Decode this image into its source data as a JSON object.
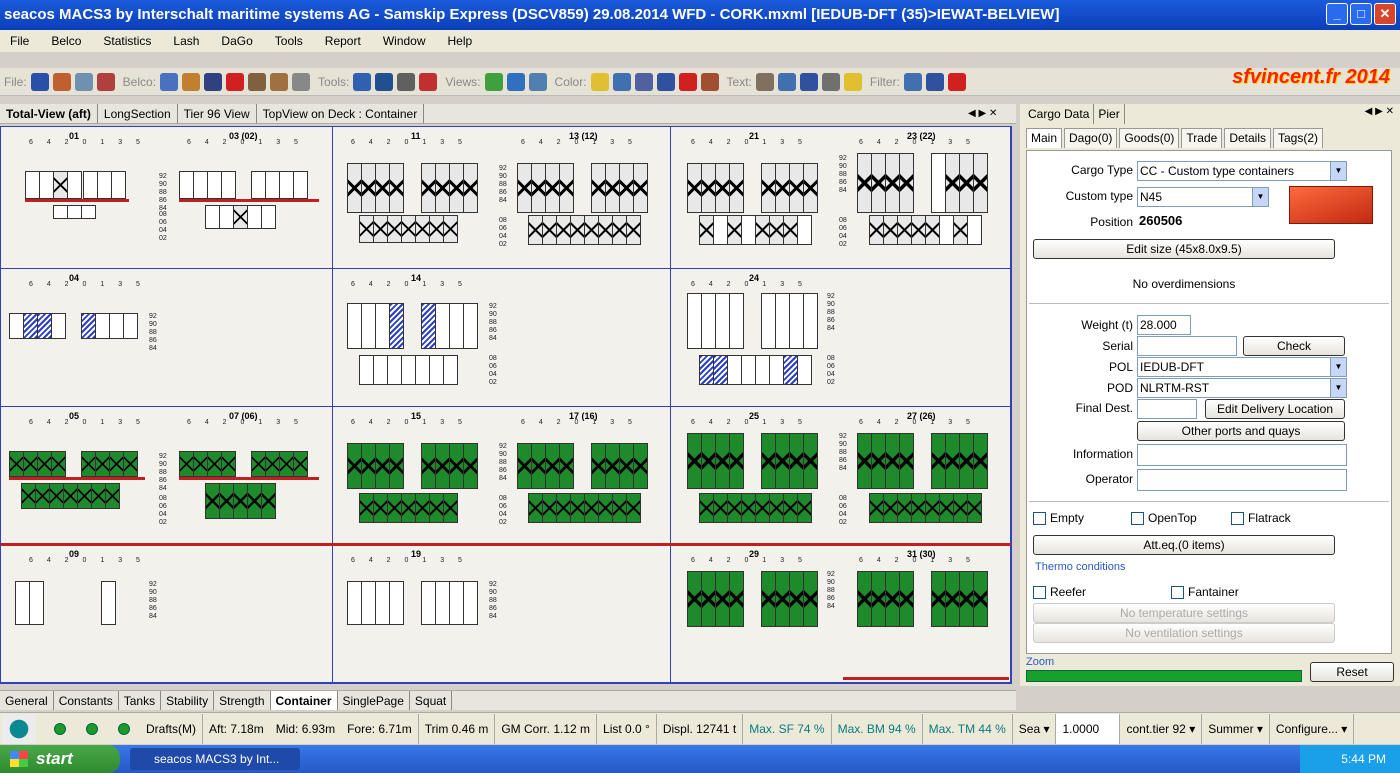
{
  "window": {
    "title": "seacos MACS3 by Interschalt maritime systems AG - Samskip Express (DSCV859)   29.08.2014     WFD - CORK.mxml [IEDUB-DFT (35)>IEWAT-BELVIEW]"
  },
  "menu": [
    "File",
    "Belco",
    "Statistics",
    "Lash",
    "DaGo",
    "Tools",
    "Report",
    "Window",
    "Help"
  ],
  "toolbar": {
    "groups": [
      "File:",
      "Belco:",
      "Tools:",
      "Views:",
      "Color:",
      "Text:",
      "Filter:"
    ]
  },
  "watermark": "sfvincent.fr 2014",
  "view_tabs": [
    {
      "label": "Total-View (aft)",
      "active": true
    },
    {
      "label": "LongSection"
    },
    {
      "label": "Tier 96 View"
    },
    {
      "label": "TopView on Deck : Container"
    }
  ],
  "bays": {
    "b01": "01",
    "b03": "03 (02)",
    "b11": "11",
    "b13": "13 (12)",
    "b21": "21",
    "b23": "23 (22)",
    "b04": "04",
    "b14": "14",
    "b24": "24",
    "b05": "05",
    "b07": "07 (06)",
    "b15": "15",
    "b17": "17 (16)",
    "b25": "25",
    "b27": "27 (26)",
    "b09": "09",
    "b19": "19",
    "b29": "29",
    "b31": "31 (30)"
  },
  "tiers_deck": [
    "92",
    "90",
    "88",
    "86",
    "84"
  ],
  "tiers_hold": [
    "08",
    "06",
    "04",
    "02"
  ],
  "positions": "6 4 2 0 1 3 5",
  "bottom_tabs": [
    {
      "label": "General"
    },
    {
      "label": "Constants"
    },
    {
      "label": "Tanks"
    },
    {
      "label": "Stability"
    },
    {
      "label": "Strength"
    },
    {
      "label": "Container",
      "active": true
    },
    {
      "label": "SinglePage"
    },
    {
      "label": "Squat"
    }
  ],
  "status": {
    "drafts": "Drafts(M)",
    "aft": "Aft: 7.18m",
    "mid": "Mid: 6.93m",
    "fore": "Fore: 6.71m",
    "trim": "Trim 0.46 m",
    "gm": "GM Corr. 1.12 m",
    "list": "List 0.0 °",
    "displ": "Displ. 12741 t",
    "sf": "Max. SF 74 %",
    "bm": "Max. BM 94 %",
    "tm": "Max. TM 44 %",
    "sea": "Sea",
    "factor": "1.0000",
    "tier": "cont.tier 92",
    "season": "Summer",
    "configure": "Configure..."
  },
  "taskbar": {
    "start": "start",
    "task": "seacos MACS3 by Int...",
    "clock": "5:44 PM"
  },
  "panel": {
    "tabs_top": [
      "Cargo Data",
      "Pier"
    ],
    "tabs": [
      {
        "label": "Main",
        "active": true
      },
      {
        "label": "Dago(0)"
      },
      {
        "label": "Goods(0)"
      },
      {
        "label": "Trade"
      },
      {
        "label": "Details"
      },
      {
        "label": "Tags(2)"
      }
    ],
    "cargo_type_label": "Cargo Type",
    "cargo_type": "CC - Custom type containers",
    "custom_type_label": "Custom type",
    "custom_type": "N45",
    "position_label": "Position",
    "position": "260506",
    "edit_size": "Edit size (45x8.0x9.5)",
    "overdim": "No overdimensions",
    "weight_label": "Weight (t)",
    "weight": "28.000",
    "serial_label": "Serial",
    "serial": "",
    "check": "Check",
    "pol_label": "POL",
    "pol": "IEDUB-DFT",
    "pod_label": "POD",
    "pod": "NLRTM-RST",
    "final_label": "Final Dest.",
    "final": "",
    "edit_delivery": "Edit Delivery Location",
    "other_ports": "Other ports and quays",
    "info_label": "Information",
    "info": "",
    "operator_label": "Operator",
    "operator": "",
    "empty": "Empty",
    "opentop": "OpenTop",
    "flatrack": "Flatrack",
    "att_eq": "Att.eq.(0 items)",
    "thermo": "Thermo conditions",
    "reefer": "Reefer",
    "fantainer": "Fantainer",
    "no_temp": "No temperature settings",
    "no_vent": "No ventilation settings",
    "zoom": "Zoom",
    "reset": "Reset"
  }
}
